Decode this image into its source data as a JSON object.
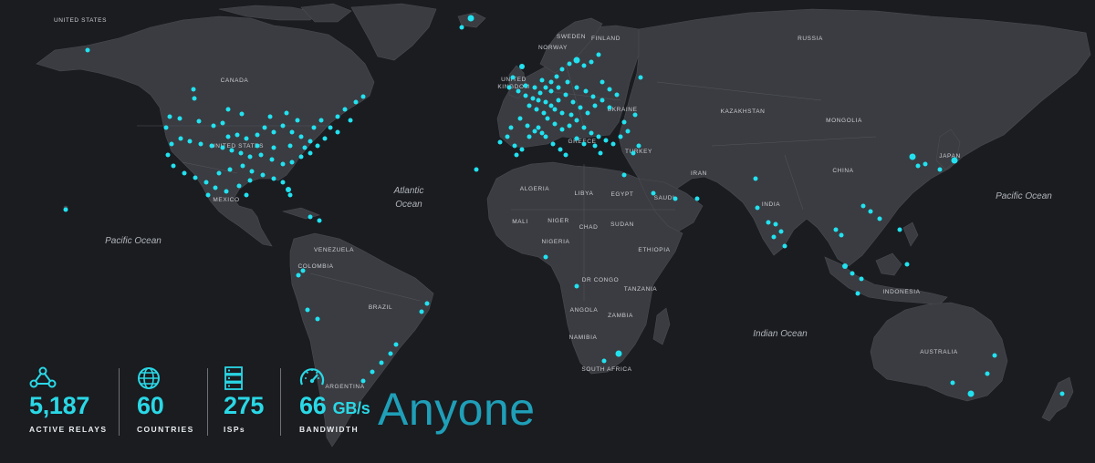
{
  "map": {
    "oceans": [
      {
        "name": "Atlantic",
        "line2": "Ocean"
      },
      {
        "name": "Pacific Ocean"
      },
      {
        "name": "Pacific Ocean"
      },
      {
        "name": "Indian Ocean"
      }
    ],
    "countries": {
      "united_states_ak": "UNITED STATES",
      "canada": "CANADA",
      "united_states": "UNITED STATES",
      "mexico": "MEXICO",
      "venezuela": "VENEZUELA",
      "colombia": "COLOMBIA",
      "brazil": "BRAZIL",
      "argentina": "ARGENTINA",
      "sweden": "SWEDEN",
      "finland": "FINLAND",
      "norway": "NORWAY",
      "united_kingdom_1": "UNITED",
      "united_kingdom_2": "KINGDOM",
      "ukraine": "UKRAINE",
      "greece": "GREECE",
      "turkey": "TURKEY",
      "russia": "RUSSIA",
      "kazakhstan": "KAZAKHSTAN",
      "mongolia": "MONGOLIA",
      "china": "CHINA",
      "japan": "JAPAN",
      "iran": "IRAN",
      "india": "INDIA",
      "indonesia": "INDONESIA",
      "australia": "AUSTRALIA",
      "algeria": "ALGERIA",
      "libya": "LIBYA",
      "egypt": "EGYPT",
      "mali": "MALI",
      "niger": "NIGER",
      "chad": "CHAD",
      "sudan": "SUDAN",
      "nigeria": "NIGERIA",
      "ethiopia": "ETHIOPIA",
      "dr_congo": "DR CONGO",
      "tanzania": "TANZANIA",
      "angola": "ANGOLA",
      "zambia": "ZAMBIA",
      "namibia": "NAMIBIA",
      "south_africa": "SOUTH AFRICA",
      "saudi": "SAUDI"
    },
    "relay_color": "#22e2f0"
  },
  "stats": [
    {
      "icon": "network-icon",
      "value": "5,187",
      "unit": "",
      "label": "ACTIVE RELAYS"
    },
    {
      "icon": "globe-icon",
      "value": "60",
      "unit": "",
      "label": "COUNTRIES"
    },
    {
      "icon": "server-icon",
      "value": "275",
      "unit": "",
      "label": "ISPs"
    },
    {
      "icon": "speedometer-icon",
      "value": "66",
      "unit": "GB/s",
      "label": "BANDWIDTH"
    }
  ],
  "brand": {
    "name": "Anyone",
    "color": "#1f9fb8"
  },
  "colors": {
    "accent": "#2ad8e6",
    "background": "#1a1c20",
    "land": "#3a3c41"
  }
}
